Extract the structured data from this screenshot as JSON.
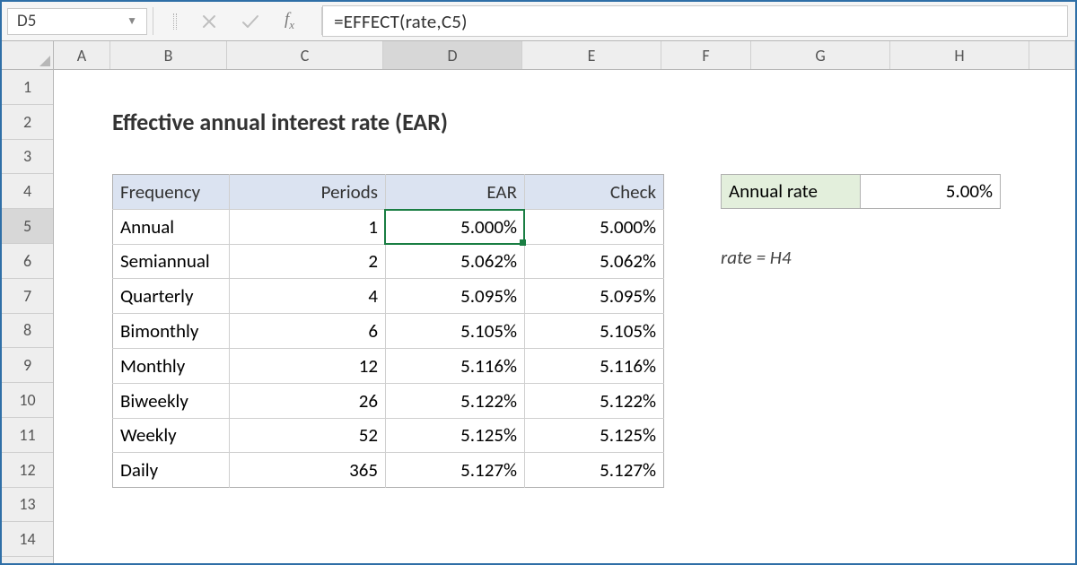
{
  "formula_bar": {
    "cell_ref": "D5",
    "formula": "=EFFECT(rate,C5)"
  },
  "columns": [
    "A",
    "B",
    "C",
    "D",
    "E",
    "F",
    "G",
    "H"
  ],
  "rows": [
    "1",
    "2",
    "3",
    "4",
    "5",
    "6",
    "7",
    "8",
    "9",
    "10",
    "11",
    "12",
    "13",
    "14"
  ],
  "title": "Effective annual interest rate (EAR)",
  "table": {
    "headers": {
      "freq": "Frequency",
      "periods": "Periods",
      "ear": "EAR",
      "check": "Check"
    },
    "rows": [
      {
        "freq": "Annual",
        "periods": "1",
        "ear": "5.000%",
        "check": "5.000%"
      },
      {
        "freq": "Semiannual",
        "periods": "2",
        "ear": "5.062%",
        "check": "5.062%"
      },
      {
        "freq": "Quarterly",
        "periods": "4",
        "ear": "5.095%",
        "check": "5.095%"
      },
      {
        "freq": "Bimonthly",
        "periods": "6",
        "ear": "5.105%",
        "check": "5.105%"
      },
      {
        "freq": "Monthly",
        "periods": "12",
        "ear": "5.116%",
        "check": "5.116%"
      },
      {
        "freq": "Biweekly",
        "periods": "26",
        "ear": "5.122%",
        "check": "5.122%"
      },
      {
        "freq": "Weekly",
        "periods": "52",
        "ear": "5.125%",
        "check": "5.125%"
      },
      {
        "freq": "Daily",
        "periods": "365",
        "ear": "5.127%",
        "check": "5.127%"
      }
    ]
  },
  "rate": {
    "label": "Annual rate",
    "value": "5.00%"
  },
  "note": "rate = H4",
  "chart_data": {
    "type": "table",
    "title": "Effective annual interest rate (EAR)",
    "columns": [
      "Frequency",
      "Periods",
      "EAR",
      "Check"
    ],
    "rows": [
      [
        "Annual",
        1,
        0.05,
        0.05
      ],
      [
        "Semiannual",
        2,
        0.05062,
        0.05062
      ],
      [
        "Quarterly",
        4,
        0.05095,
        0.05095
      ],
      [
        "Bimonthly",
        6,
        0.05105,
        0.05105
      ],
      [
        "Monthly",
        12,
        0.05116,
        0.05116
      ],
      [
        "Biweekly",
        26,
        0.05122,
        0.05122
      ],
      [
        "Weekly",
        52,
        0.05125,
        0.05125
      ],
      [
        "Daily",
        365,
        0.05127,
        0.05127
      ]
    ],
    "annual_rate": 0.05,
    "rate_named_range": "H4",
    "formula": "=EFFECT(rate,C5)"
  }
}
